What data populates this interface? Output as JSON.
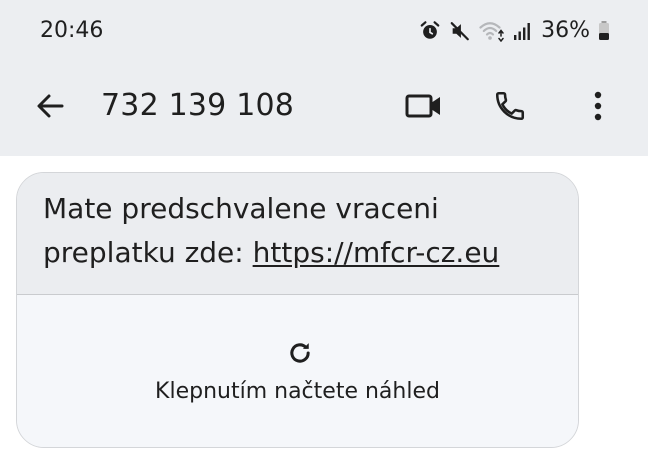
{
  "status_bar": {
    "time": "20:46",
    "battery": "36%",
    "icons": [
      "alarm-icon",
      "mute-icon",
      "wifi-icon",
      "signal-icon",
      "battery-icon"
    ]
  },
  "app_bar": {
    "title": "732 139 108",
    "icons": [
      "back-arrow-icon",
      "video-call-icon",
      "phone-icon",
      "more-vert-icon"
    ]
  },
  "message": {
    "text_before_link": "Mate predschvalene vraceni preplatku zde: ",
    "link_text": "https://mfcr-cz.eu",
    "preview": {
      "label": "Klepnutím načtete náhled",
      "icon": "reload-icon"
    }
  },
  "colors": {
    "header_bg": "#eceef1",
    "bubble_bg": "#ebedf0",
    "preview_bg": "#f5f7fa",
    "text": "#1f1f1f"
  }
}
